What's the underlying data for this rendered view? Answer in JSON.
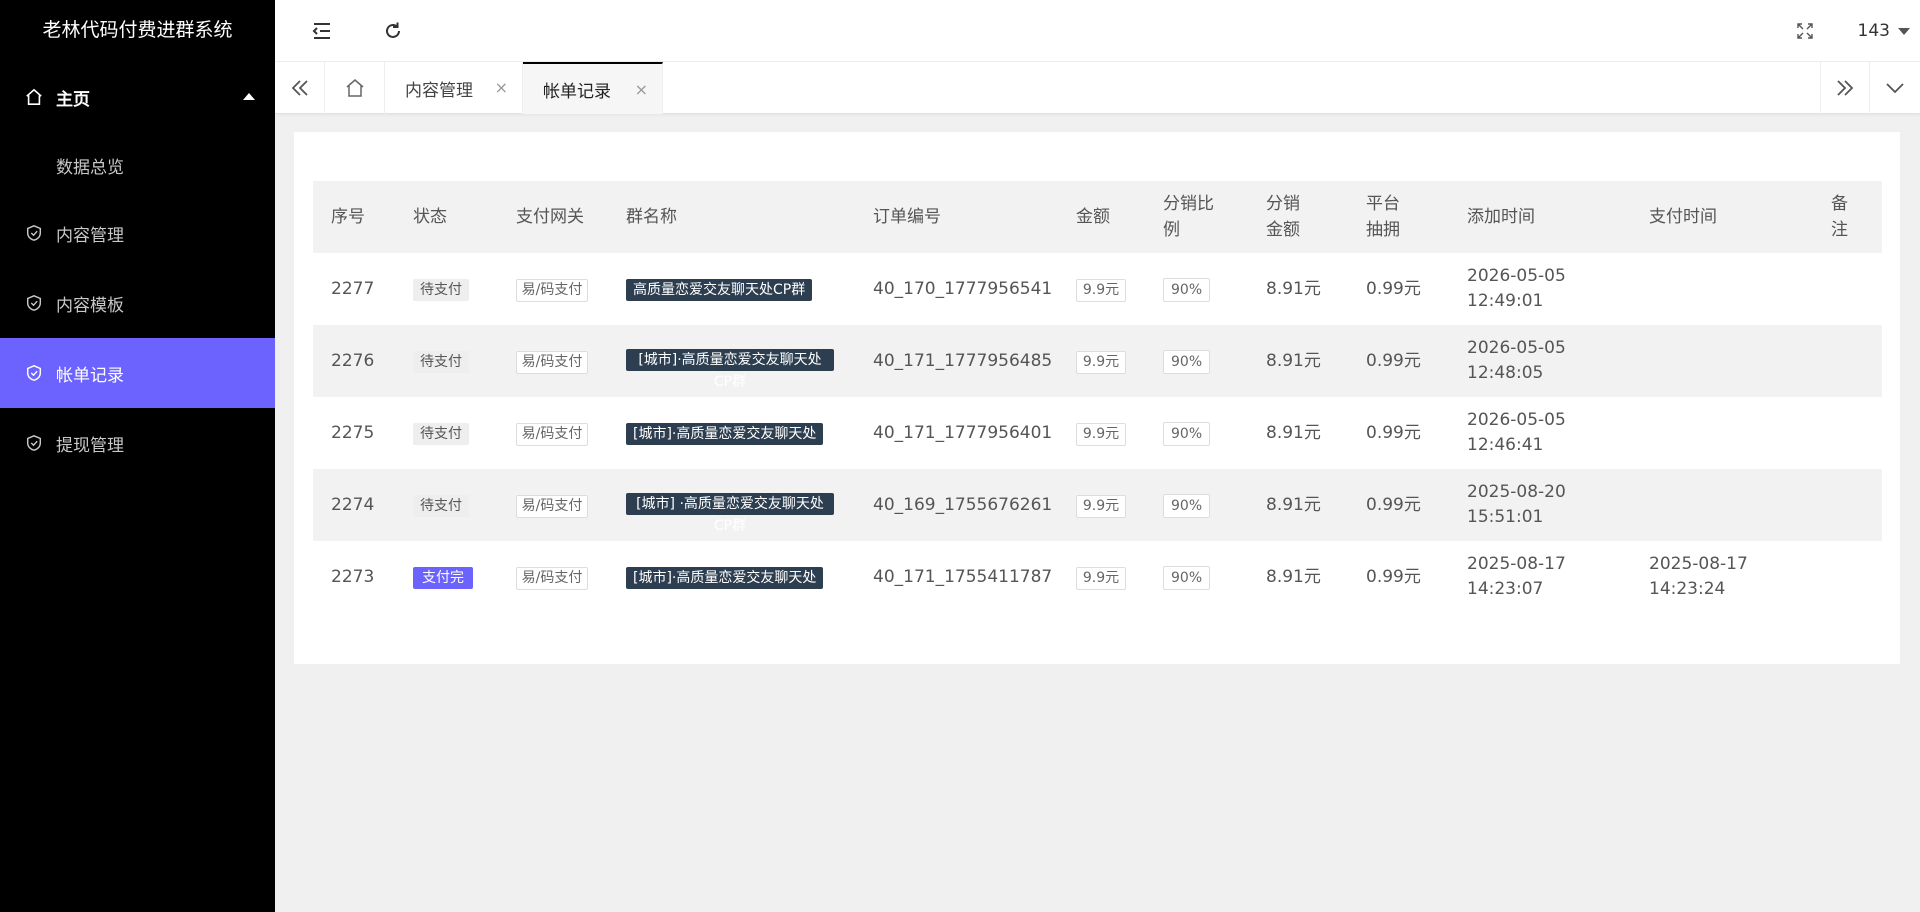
{
  "app": {
    "title": "老林代码付费进群系统"
  },
  "sidebar": {
    "home": "主页",
    "sub_items": [
      "数据总览"
    ],
    "items": [
      {
        "label": "内容管理",
        "active": false
      },
      {
        "label": "内容模板",
        "active": false
      },
      {
        "label": "帐单记录",
        "active": true
      },
      {
        "label": "提现管理",
        "active": false
      }
    ]
  },
  "header": {
    "user": "143"
  },
  "tabs": [
    {
      "label": "内容管理",
      "close": "×"
    },
    {
      "label": "帐单记录",
      "close": "×"
    }
  ],
  "table": {
    "headers": [
      "序号",
      "状态",
      "支付网关",
      "群名称",
      "订单编号",
      "金额",
      "分销比例",
      "分销金额",
      "平台抽拥",
      "添加时间",
      "支付时间",
      "备注"
    ],
    "rows": [
      {
        "id": "2277",
        "status": "待支付",
        "paid": false,
        "gateway": "易/码支付",
        "group": "高质量恋爱交友聊天处CP群",
        "order": "40_170_1777956541",
        "amount": "9.9元",
        "ratio": "90%",
        "dist": "8.91元",
        "fee": "0.99元",
        "added": "2026-05-05 12:49:01",
        "paid_time": "",
        "note": ""
      },
      {
        "id": "2276",
        "status": "待支付",
        "paid": false,
        "gateway": "易/码支付",
        "group": "[城市]·高质量恋爱交友聊天处CP群",
        "order": "40_171_1777956485",
        "amount": "9.9元",
        "ratio": "90%",
        "dist": "8.91元",
        "fee": "0.99元",
        "added": "2026-05-05 12:48:05",
        "paid_time": "",
        "note": ""
      },
      {
        "id": "2275",
        "status": "待支付",
        "paid": false,
        "gateway": "易/码支付",
        "group": "[城市]·高质量恋爱交友聊天处",
        "order": "40_171_1777956401",
        "amount": "9.9元",
        "ratio": "90%",
        "dist": "8.91元",
        "fee": "0.99元",
        "added": "2026-05-05 12:46:41",
        "paid_time": "",
        "note": ""
      },
      {
        "id": "2274",
        "status": "待支付",
        "paid": false,
        "gateway": "易/码支付",
        "group": "[城市] ·高质量恋爱交友聊天处CP群",
        "order": "40_169_1755676261",
        "amount": "9.9元",
        "ratio": "90%",
        "dist": "8.91元",
        "fee": "0.99元",
        "added": "2025-08-20 15:51:01",
        "paid_time": "",
        "note": ""
      },
      {
        "id": "2273",
        "status": "支付完",
        "paid": true,
        "gateway": "易/码支付",
        "group": "[城市]·高质量恋爱交友聊天处",
        "order": "40_171_1755411787",
        "amount": "9.9元",
        "ratio": "90%",
        "dist": "8.91元",
        "fee": "0.99元",
        "added": "2025-08-17 14:23:07",
        "paid_time": "2025-08-17 14:23:24",
        "note": ""
      }
    ]
  },
  "colors": {
    "accent": "#6c63ff",
    "sidebar_bg": "#000000",
    "group_tag": "#2c3e50"
  }
}
